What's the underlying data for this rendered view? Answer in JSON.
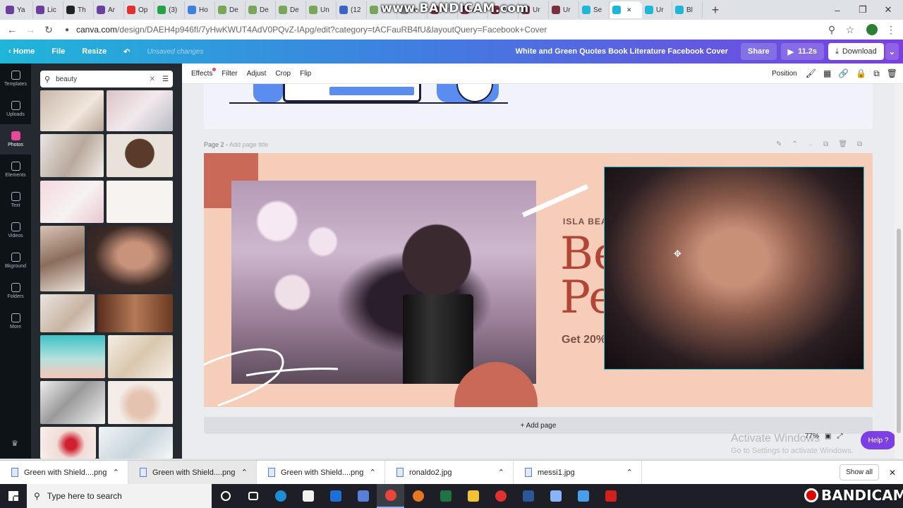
{
  "browser": {
    "tabs": [
      {
        "label": "Ya",
        "color": "#6b3fa0"
      },
      {
        "label": "Lic",
        "color": "#6b3fa0"
      },
      {
        "label": "Th",
        "color": "#222222"
      },
      {
        "label": "Ar",
        "color": "#6b3fa0"
      },
      {
        "label": "Op",
        "color": "#e03030"
      },
      {
        "label": "(3)",
        "color": "#25a244"
      },
      {
        "label": "Ho",
        "color": "#3f7fe0"
      },
      {
        "label": "De",
        "color": "#7aa65a"
      },
      {
        "label": "De",
        "color": "#7aa65a"
      },
      {
        "label": "De",
        "color": "#7aa65a"
      },
      {
        "label": "Un",
        "color": "#7aa65a"
      },
      {
        "label": "(12",
        "color": "#3b62c4"
      },
      {
        "label": "Un",
        "color": "#7aa65a"
      },
      {
        "label": "re",
        "color": "#888888"
      },
      {
        "label": "Ur",
        "color": "#7a3040"
      },
      {
        "label": "Ac",
        "color": "#7a3040"
      },
      {
        "label": "Ac",
        "color": "#7a3040"
      },
      {
        "label": "Ur",
        "color": "#7a3040"
      },
      {
        "label": "Ur",
        "color": "#7a3040"
      },
      {
        "label": "Se",
        "color": "#1fb6d8"
      },
      {
        "label": "",
        "color": "#1fb6d8",
        "active": true
      },
      {
        "label": "Ur",
        "color": "#1fb6d8"
      },
      {
        "label": "Bl",
        "color": "#1fb6d8"
      }
    ],
    "url_host": "canva.com",
    "url_path": "/design/DAEH4p946fI/7yHwKWUT4AdV0PQvZ-IApg/edit?category=tACFauRB4fU&layoutQuery=Facebook+Cover",
    "watermark_top": "www.BANDICAM.com"
  },
  "canva": {
    "home": "Home",
    "file": "File",
    "resize": "Resize",
    "unsaved": "Unsaved changes",
    "design_title": "White and Green Quotes Book Literature Facebook Cover",
    "share": "Share",
    "timer": "11.2s",
    "download": "Download"
  },
  "rail": [
    {
      "label": "Templates"
    },
    {
      "label": "Uploads"
    },
    {
      "label": "Photos",
      "selected": true
    },
    {
      "label": "Elements"
    },
    {
      "label": "Text"
    },
    {
      "label": "Videos"
    },
    {
      "label": "Bkground"
    },
    {
      "label": "Folders"
    },
    {
      "label": "More"
    }
  ],
  "search": {
    "query": "beauty"
  },
  "toolbar": {
    "effects": "Effects",
    "filter": "Filter",
    "adjust": "Adjust",
    "crop": "Crop",
    "flip": "Flip",
    "position": "Position"
  },
  "page2": {
    "label": "Page 2 -",
    "title_placeholder": "Add page title",
    "kicker": "ISLA BEAUTY CENTER",
    "headline1": "Beauty and",
    "headline2": "PeacePromo",
    "sub": "Get 20% off from July 1 to 15"
  },
  "add_page": "+ Add page",
  "zoom": "77%",
  "help": "Help ?",
  "activate": {
    "title": "Activate Windows",
    "sub": "Go to Settings to activate Windows."
  },
  "downloads": [
    {
      "name": "Green with Shield....png"
    },
    {
      "name": "Green with Shield....png"
    },
    {
      "name": "Green with Shield....png"
    },
    {
      "name": "ronaldo2.jpg"
    },
    {
      "name": "messi1.jpg"
    }
  ],
  "show_all": "Show all",
  "taskbar": {
    "search": "Type here to search",
    "watermark": "BANDICAM"
  }
}
